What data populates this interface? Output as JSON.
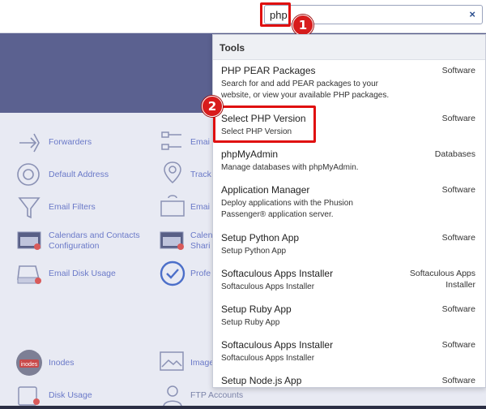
{
  "search": {
    "value": "php",
    "clear_label": "×"
  },
  "badges": {
    "one": "1",
    "two": "2"
  },
  "panel": {
    "heading": "Tools",
    "items": [
      {
        "name": "PHP PEAR Packages",
        "desc": "Search for and add PEAR packages to your website, or view your available PHP packages.",
        "category": "Software"
      },
      {
        "name": "Select PHP Version",
        "desc": "Select PHP Version",
        "category": "Software"
      },
      {
        "name": "phpMyAdmin",
        "desc": "Manage databases with phpMyAdmin.",
        "category": "Databases"
      },
      {
        "name": "Application Manager",
        "desc": "Deploy applications with the Phusion Passenger® application server.",
        "category": "Software"
      },
      {
        "name": "Setup Python App",
        "desc": "Setup Python App",
        "category": "Software"
      },
      {
        "name": "Softaculous Apps Installer",
        "desc": "Softaculous Apps Installer",
        "category": "Softaculous Apps Installer"
      },
      {
        "name": "Setup Ruby App",
        "desc": "Setup Ruby App",
        "category": "Software"
      },
      {
        "name": "Softaculous Apps Installer",
        "desc": "Softaculous Apps Installer",
        "category": "Software"
      },
      {
        "name": "Setup Node.js App",
        "desc": "",
        "category": "Software"
      }
    ]
  },
  "email_tools": {
    "forwarders": "Forwarders",
    "default_address": "Default Address",
    "email_filters": "Email Filters",
    "calendars": "Calendars and Contacts Configuration",
    "disk_usage": "Email Disk Usage"
  },
  "partial_labels": {
    "email1": "Emai",
    "track": "Track",
    "email2": "Emai",
    "calendars2": "Calen",
    "sharing2": "Shari",
    "profe": "Profe"
  },
  "files": {
    "inodes": "Inodes",
    "inodes_icon_text": "inodes",
    "images": "Image",
    "disk_usage": "Disk Usage",
    "ftp": "FTP Accounts"
  },
  "colors": {
    "accent": "#6a79c8",
    "hero": "#5b6190",
    "highlight": "#e01010"
  }
}
